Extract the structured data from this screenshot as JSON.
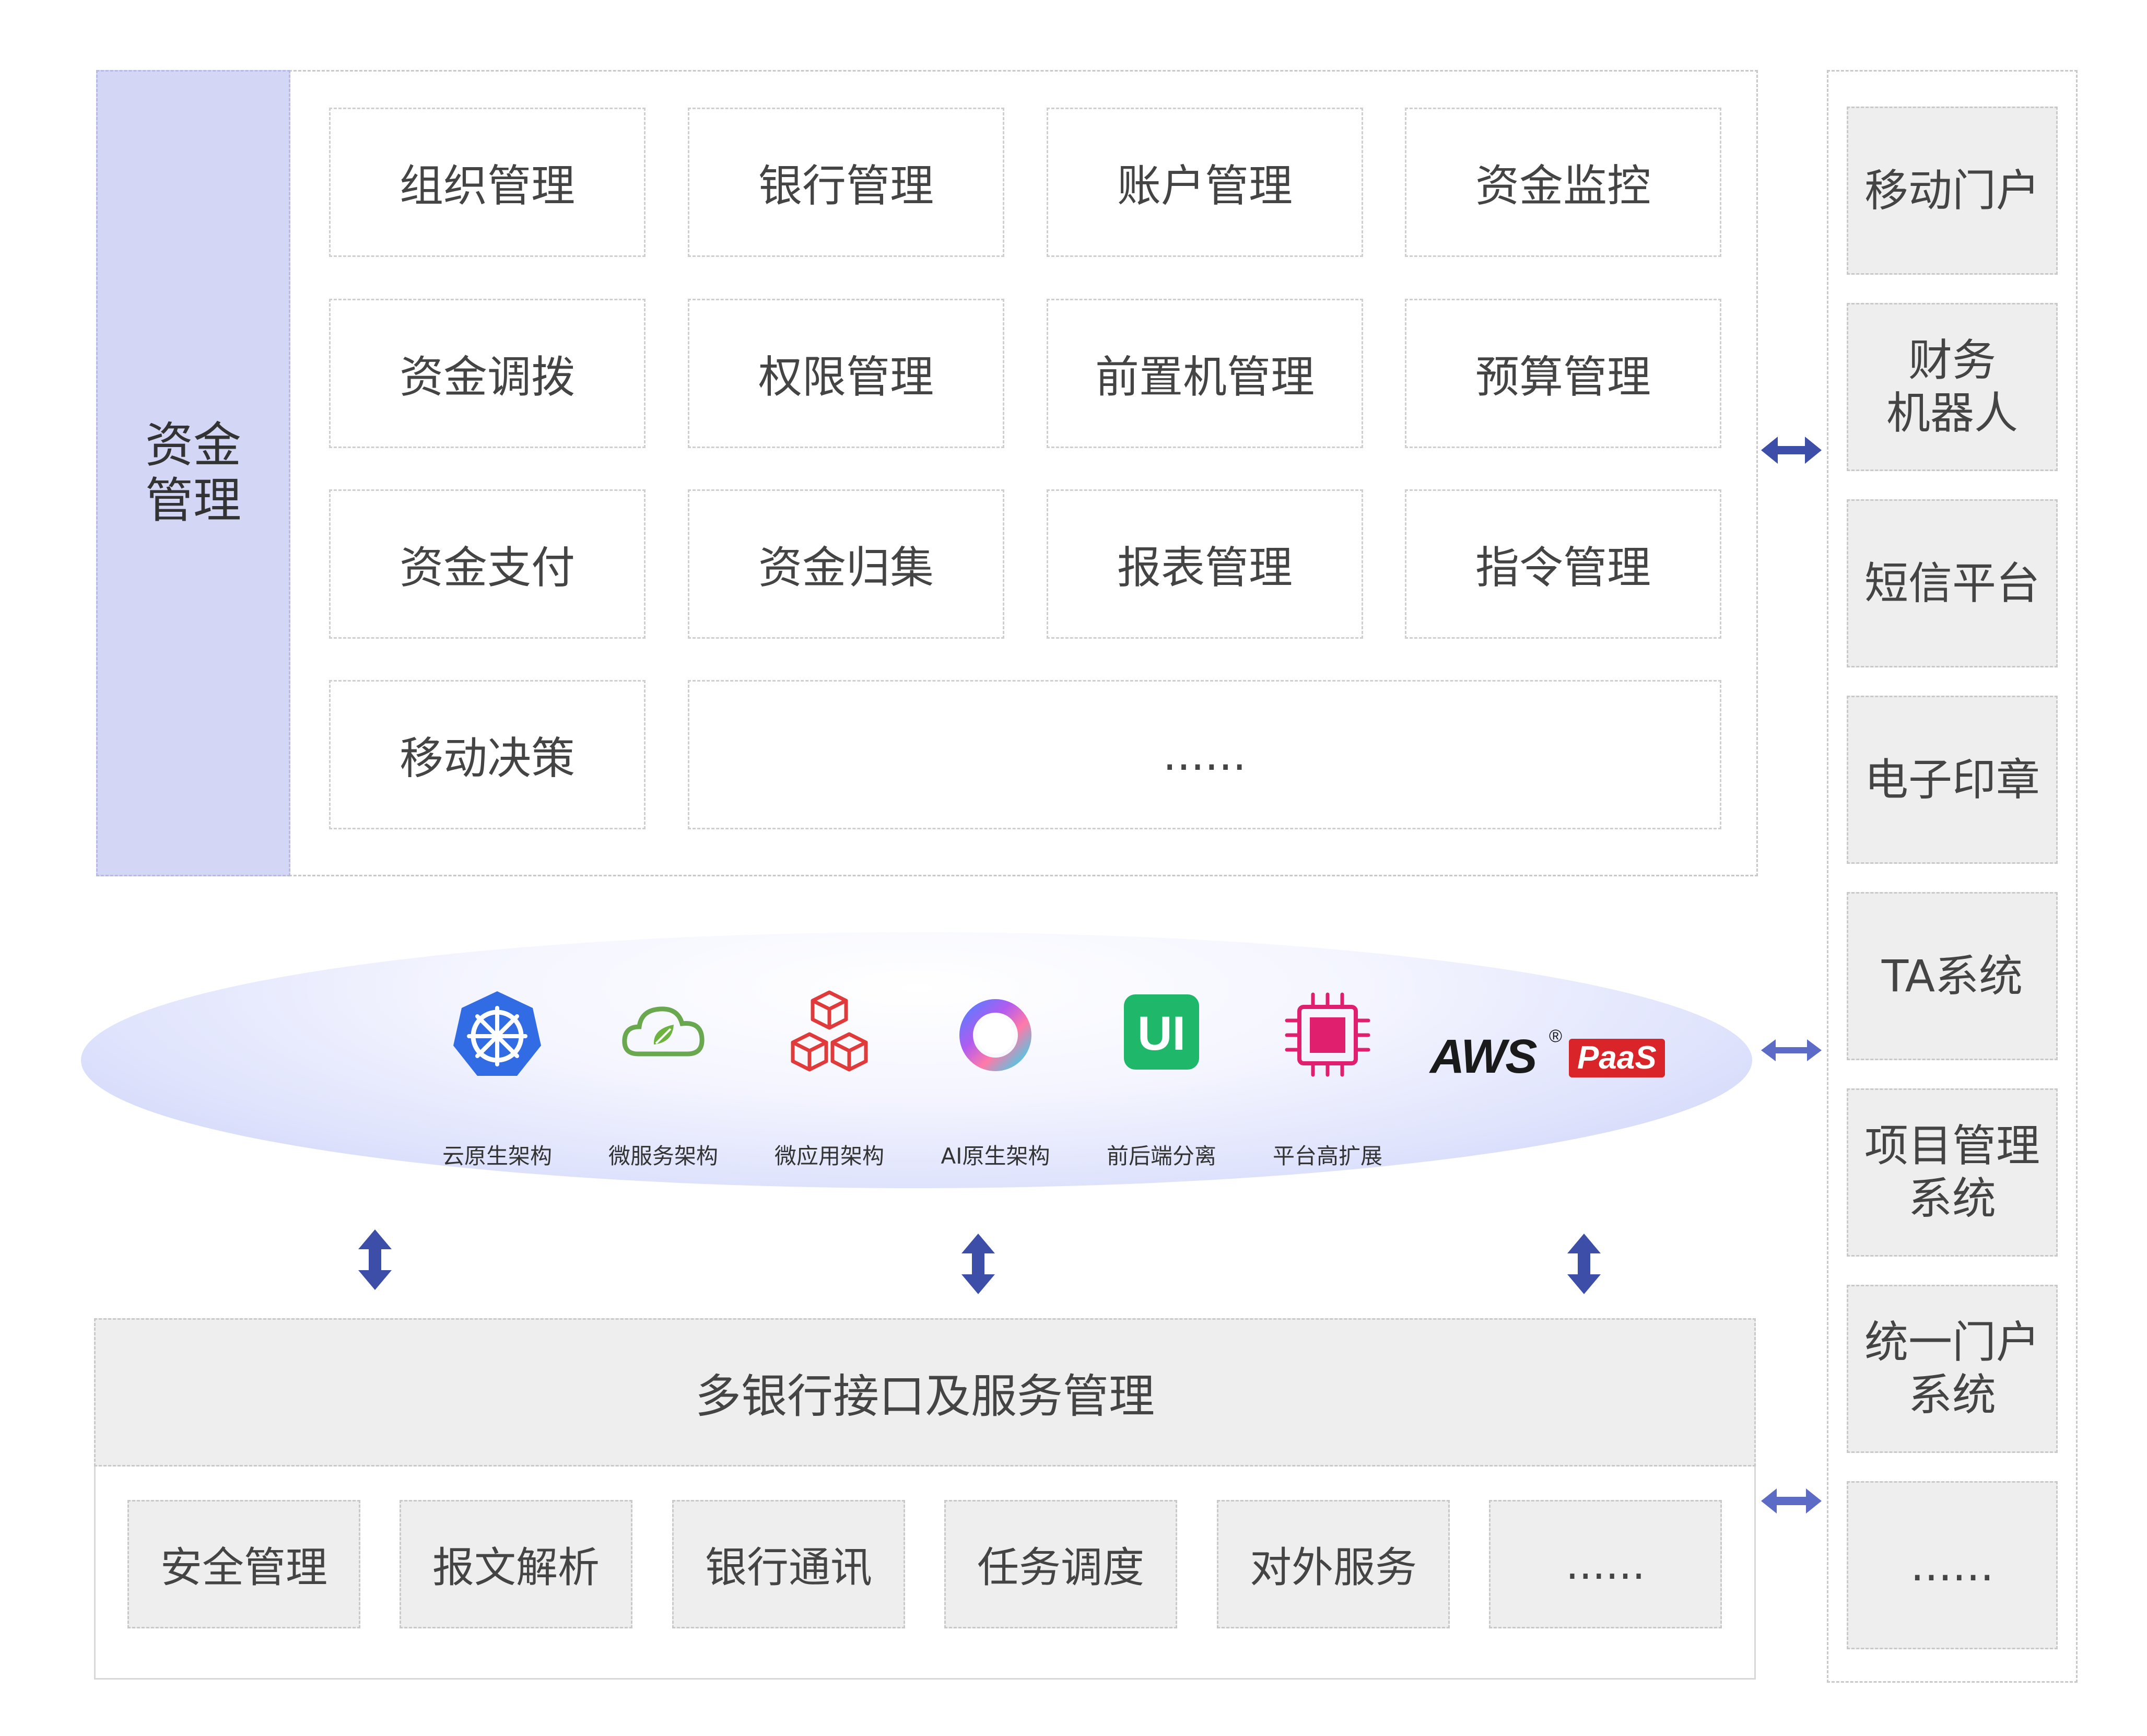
{
  "funds_management": {
    "title": "资金\n管理",
    "modules": [
      "组织管理",
      "银行管理",
      "账户管理",
      "资金监控",
      "资金调拨",
      "权限管理",
      "前置机管理",
      "预算管理",
      "资金支付",
      "资金归集",
      "报表管理",
      "指令管理",
      "移动决策",
      "......"
    ]
  },
  "tech": {
    "items": [
      {
        "label": "云原生架构",
        "icon": "kubernetes-icon"
      },
      {
        "label": "微服务架构",
        "icon": "spring-cloud-icon"
      },
      {
        "label": "微应用架构",
        "icon": "cubes-icon"
      },
      {
        "label": "AI原生架构",
        "icon": "ai-ring-icon"
      },
      {
        "label": "前后端分离",
        "icon": "ui-icon"
      },
      {
        "label": "平台高扩展",
        "icon": "chip-icon"
      }
    ],
    "brand": {
      "aws": "AWS",
      "reg": "®",
      "paas": "PaaS"
    }
  },
  "interface": {
    "title": "多银行接口及服务管理",
    "modules": [
      "安全管理",
      "报文解析",
      "银行通讯",
      "任务调度",
      "对外服务",
      "......"
    ]
  },
  "external_systems": [
    "移动门户",
    "财务\n机器人",
    "短信平台",
    "电子印章",
    "TA系统",
    "项目管理\n系统",
    "统一门户\n系统",
    "......"
  ],
  "colors": {
    "accent": "#3d4ea8",
    "side_bg": "#d3d6f4",
    "module_bg": "#eeeeee",
    "arrow_light": "#5b6bc6"
  }
}
